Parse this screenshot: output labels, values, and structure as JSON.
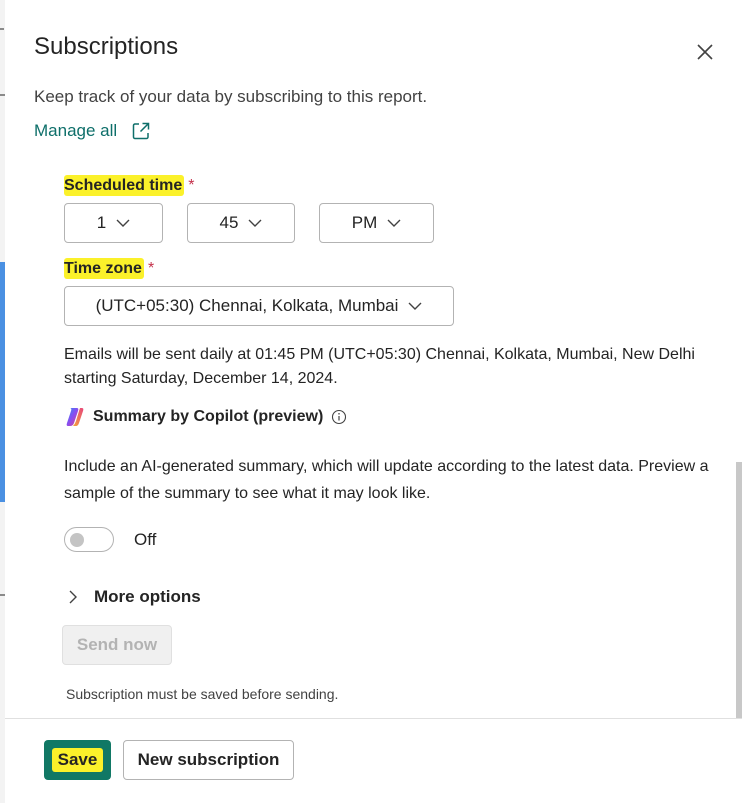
{
  "panel": {
    "title": "Subscriptions",
    "subtitle": "Keep track of your data by subscribing to this report.",
    "manage_all": "Manage all"
  },
  "schedule": {
    "label": "Scheduled time",
    "required_mark": "*",
    "hour": "1",
    "minute": "45",
    "period": "PM"
  },
  "timezone": {
    "label": "Time zone",
    "required_mark": "*",
    "value": "(UTC+05:30) Chennai, Kolkata, Mumbai"
  },
  "info_text": "Emails will be sent daily at 01:45 PM (UTC+05:30) Chennai, Kolkata, Mumbai, New Delhi starting Saturday, December 14, 2024.",
  "copilot": {
    "title": "Summary by Copilot (preview)",
    "description": "Include an AI-generated summary, which will update according to the latest data. Preview a sample of the summary to see what it may look like.",
    "toggle_state": "Off"
  },
  "more_options": "More options",
  "send_now": "Send now",
  "note": "Subscription must be saved before sending.",
  "footer": {
    "save": "Save",
    "new_subscription": "New subscription"
  },
  "colors": {
    "accent": "#117865",
    "link": "#0e6f6a",
    "highlight": "#fbf12a",
    "required": "#c4314b"
  }
}
